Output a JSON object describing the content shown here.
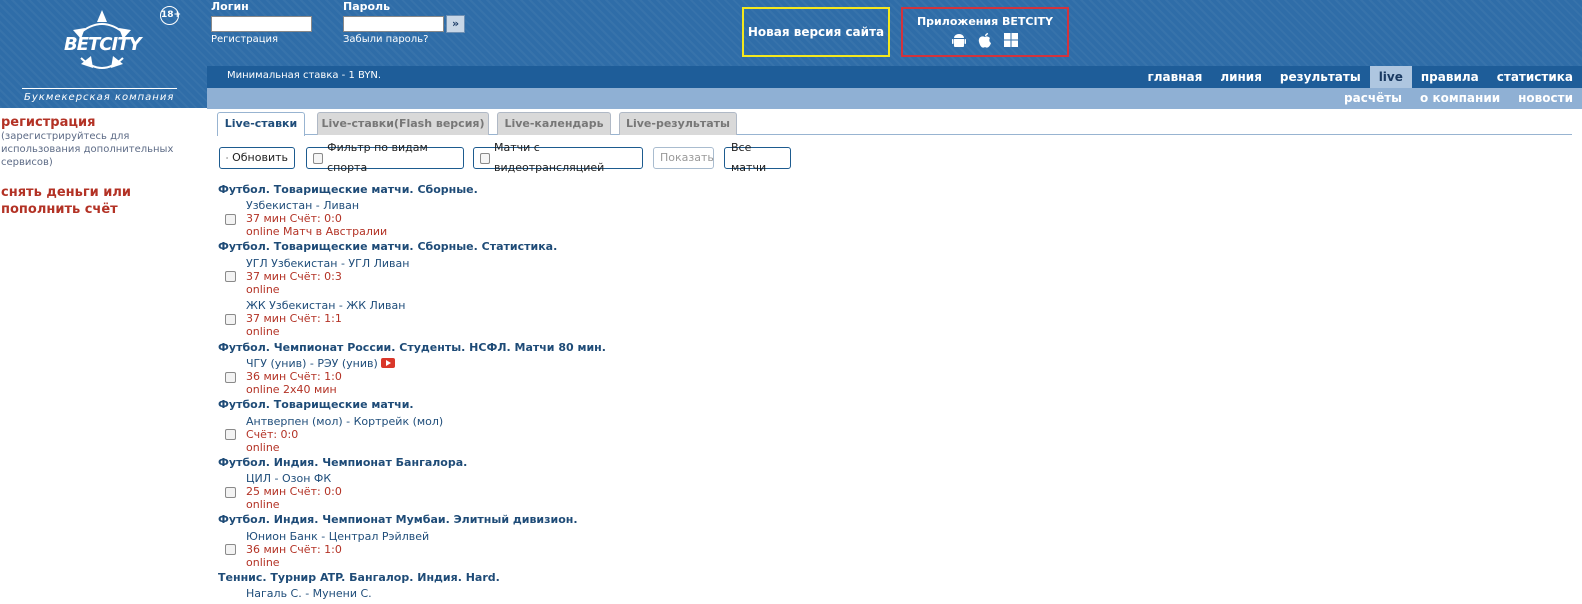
{
  "header": {
    "logo_text": "BETCITY",
    "age_badge": "18+",
    "tagline": "Букмекерская компания",
    "login_label": "Логин",
    "login_value": "",
    "password_label": "Пароль",
    "password_value": "",
    "register_link": "Регистрация",
    "forgot_link": "Забыли пароль?",
    "go_button": "»",
    "new_version": "Новая версия сайта",
    "apps_title": "Приложения BETCITY",
    "app_icons": [
      "android-icon",
      "apple-icon",
      "windows-icon"
    ]
  },
  "nav": {
    "min_bet": "Минимальная ставка - 1 BYN.",
    "primary": [
      "главная",
      "линия",
      "результаты",
      "live",
      "правила",
      "статистика"
    ],
    "active": "live",
    "secondary": [
      "расчёты",
      "о компании",
      "новости"
    ]
  },
  "sidebar": {
    "register": "регистрация",
    "register_note": "(зарегистрируйтесь для использования дополнительных сервисов)",
    "money": "снять деньги или пополнить счёт"
  },
  "tabs": [
    "Live-ставки",
    "Live-ставки(Flash версия)",
    "Live-календарь",
    "Live-результаты"
  ],
  "toolbar": {
    "refresh": "Обновить",
    "filter_sports": "Фильтр по видам спорта",
    "video_matches": "Матчи с видеотрансляцией",
    "show": "Показать",
    "all_matches": "Все матчи"
  },
  "leagues": [
    {
      "title": "Футбол. Товарищеские матчи. Сборные.",
      "matches": [
        {
          "name": "Узбекистан - Ливан",
          "score": "37 мин Счёт: 0:0",
          "status": "online Матч в Австралии"
        }
      ]
    },
    {
      "title": "Футбол. Товарищеские матчи. Сборные. Статистика.",
      "matches": [
        {
          "name": "УГЛ Узбекистан - УГЛ Ливан",
          "score": "37 мин Счёт: 0:3",
          "status": "online"
        },
        {
          "name": "ЖК Узбекистан - ЖК Ливан",
          "score": "37 мин Счёт: 1:1",
          "status": "online"
        }
      ]
    },
    {
      "title": "Футбол. Чемпионат России. Студенты. НСФЛ. Матчи 80 мин.",
      "matches": [
        {
          "name": "ЧГУ (унив) - РЭУ (унив)",
          "score": "36 мин Счёт: 1:0",
          "status": "online 2х40 мин",
          "video": true
        }
      ]
    },
    {
      "title": "Футбол. Товарищеские матчи.",
      "matches": [
        {
          "name": "Антверпен (мол) - Кортрейк (мол)",
          "score": "Счёт: 0:0",
          "status": "online"
        }
      ]
    },
    {
      "title": "Футбол. Индия. Чемпионат Бангалора.",
      "matches": [
        {
          "name": "ЦИЛ - Озон ФК",
          "score": "25 мин Счёт: 0:0",
          "status": "online"
        }
      ]
    },
    {
      "title": "Футбол. Индия. Чемпионат Мумбаи. Элитный дивизион.",
      "matches": [
        {
          "name": "Юнион Банк - Централ Рэйлвей",
          "score": "36 мин Счёт: 1:0",
          "status": "online"
        }
      ]
    },
    {
      "title": "Теннис. Турнир ATP. Бангалор. Индия. Hard.",
      "matches": [
        {
          "name": "Нагаль С. - Мунени С.",
          "score": "",
          "status": ""
        }
      ]
    }
  ]
}
